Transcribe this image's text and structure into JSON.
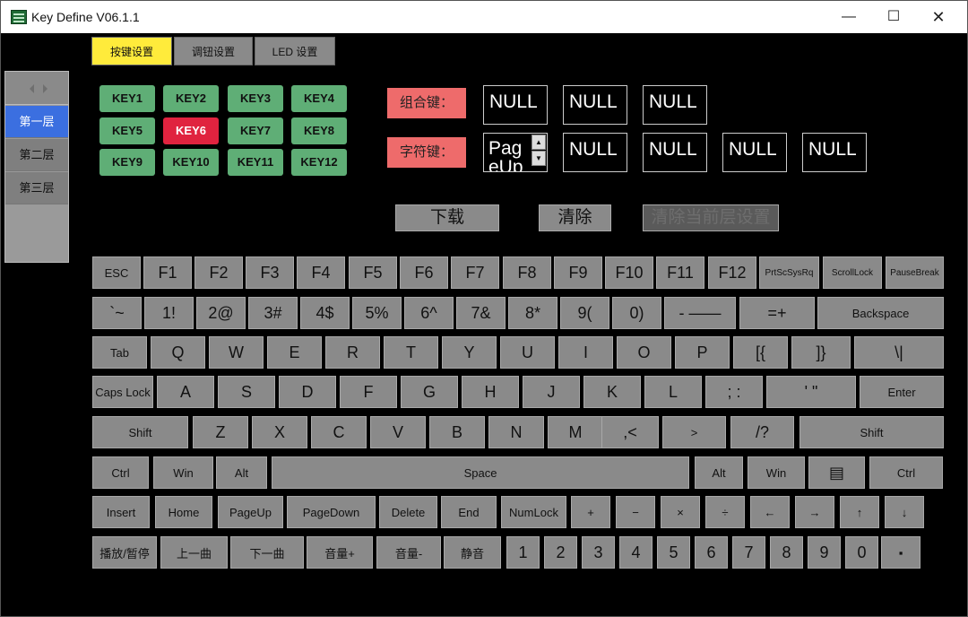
{
  "window": {
    "title": "Key Define V06.1.1"
  },
  "tabs": [
    "按键设置",
    "调钮设置",
    "LED 设置"
  ],
  "layers": [
    "第一层",
    "第二层",
    "第三层"
  ],
  "macro_keys": [
    "KEY1",
    "KEY2",
    "KEY3",
    "KEY4",
    "KEY5",
    "KEY6",
    "KEY7",
    "KEY8",
    "KEY9",
    "KEY10",
    "KEY11",
    "KEY12"
  ],
  "selected_key": "KEY6",
  "combo": {
    "label": "组合键：",
    "slots": [
      "NULL",
      "NULL",
      "NULL"
    ]
  },
  "char": {
    "label": "字符键：",
    "first_value": "PageUp",
    "slots": [
      "NULL",
      "NULL",
      "NULL",
      "NULL"
    ]
  },
  "actions": {
    "download": "下载",
    "clear": "清除",
    "disabled": "清除当前层设置"
  },
  "keyboard_rows": [
    [
      "ESC",
      "F1",
      "F2",
      "F3",
      "F4",
      "F5",
      "F6",
      "F7",
      "F8",
      "F9",
      "F10",
      "F11",
      "F12",
      "PrtScSysRq",
      "ScrollLock",
      "PauseBreak"
    ],
    [
      "`~",
      "1!",
      "2@",
      "3#",
      "4$",
      "5%",
      "6^",
      "7&",
      "8*",
      "9(",
      "0)",
      "- ——",
      "=+",
      "Backspace"
    ],
    [
      "Tab",
      "Q",
      "W",
      "E",
      "R",
      "T",
      "Y",
      "U",
      "I",
      "O",
      "P",
      "[{",
      "]}",
      "\\|"
    ],
    [
      "Caps Lock",
      "A",
      "S",
      "D",
      "F",
      "G",
      "H",
      "J",
      "K",
      "L",
      "; :",
      "' \"",
      "Enter"
    ],
    [
      "Shift",
      "Z",
      "X",
      "C",
      "V",
      "B",
      "N",
      "M",
      ",<",
      ">",
      "/?",
      "Shift"
    ],
    [
      "Ctrl",
      "Win",
      "Alt",
      "Space",
      "Alt",
      "Win",
      "▤",
      "Ctrl"
    ],
    [
      "Insert",
      "Home",
      "PageUp",
      "PageDown",
      "Delete",
      "End",
      "NumLock",
      "+",
      "−",
      "×",
      "÷",
      "←",
      "→",
      "↑",
      "↓"
    ],
    [
      "播放/暂停",
      "上一曲",
      "下一曲",
      "音量+",
      "音量-",
      "静音",
      "1",
      "2",
      "3",
      "4",
      "5",
      "6",
      "7",
      "8",
      "9",
      "0",
      "▪"
    ]
  ],
  "colors": {
    "key_green": "#5fae76",
    "key_selected": "#e0233f",
    "tab_active": "#ffeb3b",
    "layer_active": "#3b6fe0",
    "label_red": "#ee6b6b"
  }
}
